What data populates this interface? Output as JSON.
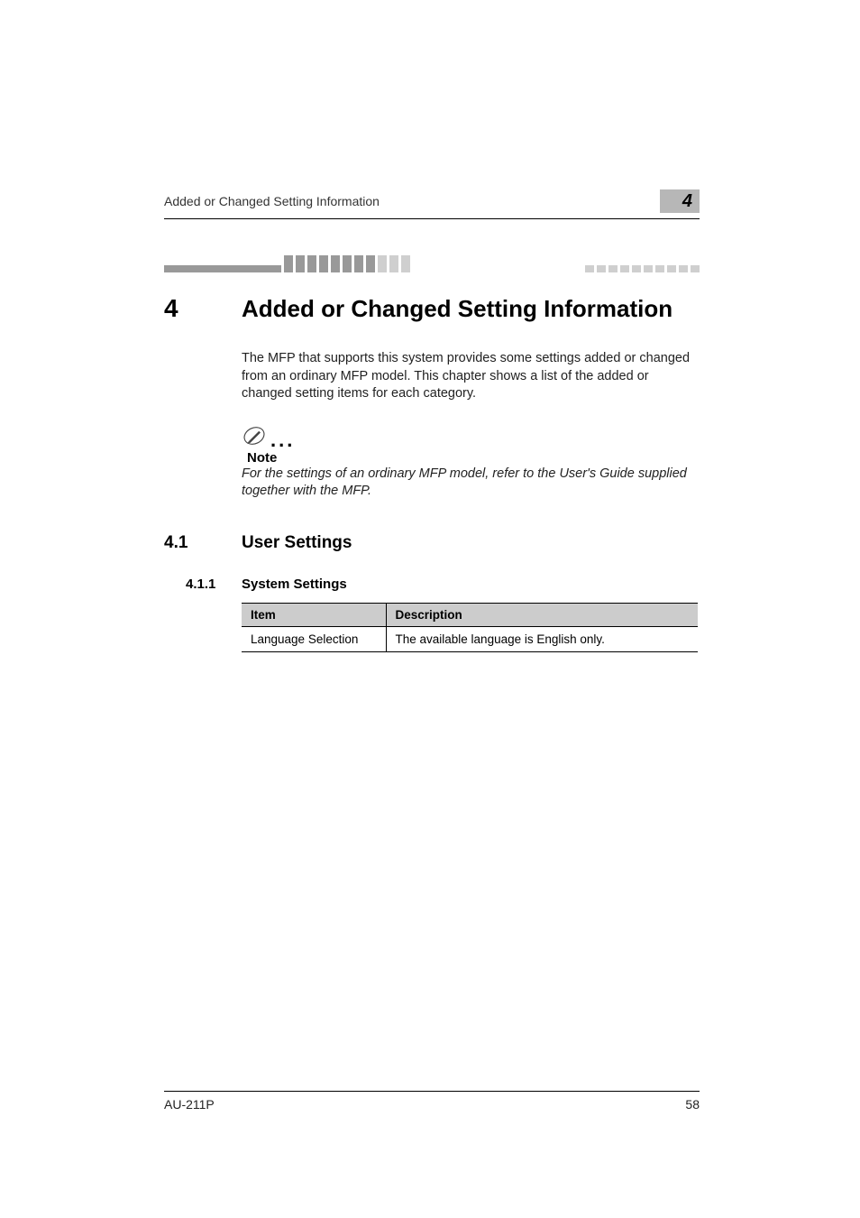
{
  "runningHeader": {
    "text": "Added or Changed Setting Information",
    "chapterNum": "4"
  },
  "h1": {
    "num": "4",
    "title": "Added or Changed Setting Information"
  },
  "intro": "The MFP that supports this system provides some settings added or changed from an ordinary MFP model. This chapter shows a list of the added or changed setting items for each category.",
  "note": {
    "label": "Note",
    "text": "For the settings of an ordinary MFP model, refer to the User's Guide supplied together with the MFP."
  },
  "h2": {
    "num": "4.1",
    "title": "User Settings"
  },
  "h3": {
    "num": "4.1.1",
    "title": "System Settings"
  },
  "table": {
    "headers": {
      "item": "Item",
      "description": "Description"
    },
    "rows": [
      {
        "item": "Language Selection",
        "description": "The available language is English only."
      }
    ]
  },
  "footer": {
    "model": "AU-211P",
    "page": "58"
  }
}
